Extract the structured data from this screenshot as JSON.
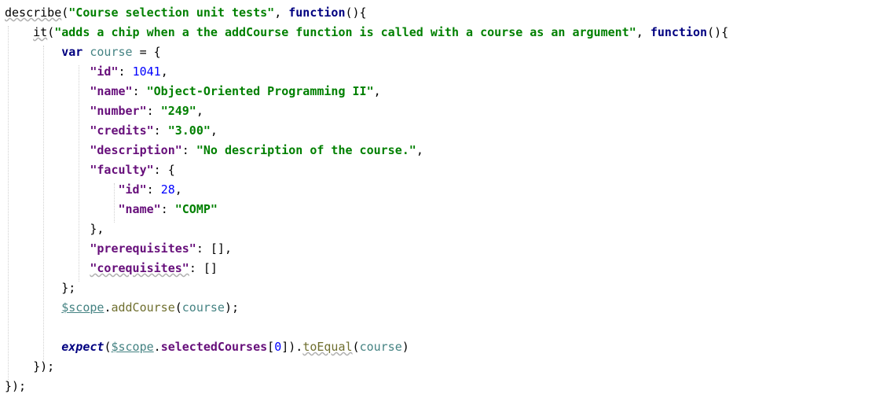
{
  "lines": [
    [
      {
        "t": "describe",
        "c": "plain",
        "w": 1
      },
      {
        "t": "(",
        "c": "plain"
      },
      {
        "t": "\"Course selection unit tests\"",
        "c": "str"
      },
      {
        "t": ", ",
        "c": "plain"
      },
      {
        "t": "function",
        "c": "kw"
      },
      {
        "t": "(){",
        "c": "plain"
      }
    ],
    [
      {
        "t": "    ",
        "c": "plain"
      },
      {
        "t": "it",
        "c": "plain",
        "w": 1
      },
      {
        "t": "(",
        "c": "plain"
      },
      {
        "t": "\"adds a chip when a the addCourse function is called with a course as an argument\"",
        "c": "str"
      },
      {
        "t": ", ",
        "c": "plain"
      },
      {
        "t": "function",
        "c": "kw"
      },
      {
        "t": "(){",
        "c": "plain"
      }
    ],
    [
      {
        "t": "        ",
        "c": "plain"
      },
      {
        "t": "var ",
        "c": "kw"
      },
      {
        "t": "course",
        "c": "var"
      },
      {
        "t": " = {",
        "c": "plain"
      }
    ],
    [
      {
        "t": "            ",
        "c": "plain"
      },
      {
        "t": "\"id\"",
        "c": "key"
      },
      {
        "t": ": ",
        "c": "plain"
      },
      {
        "t": "1041",
        "c": "num"
      },
      {
        "t": ",",
        "c": "plain"
      }
    ],
    [
      {
        "t": "            ",
        "c": "plain"
      },
      {
        "t": "\"name\"",
        "c": "key"
      },
      {
        "t": ": ",
        "c": "plain"
      },
      {
        "t": "\"Object-Oriented Programming II\"",
        "c": "str"
      },
      {
        "t": ",",
        "c": "plain"
      }
    ],
    [
      {
        "t": "            ",
        "c": "plain"
      },
      {
        "t": "\"number\"",
        "c": "key"
      },
      {
        "t": ": ",
        "c": "plain"
      },
      {
        "t": "\"249\"",
        "c": "str"
      },
      {
        "t": ",",
        "c": "plain"
      }
    ],
    [
      {
        "t": "            ",
        "c": "plain"
      },
      {
        "t": "\"credits\"",
        "c": "key"
      },
      {
        "t": ": ",
        "c": "plain"
      },
      {
        "t": "\"3.00\"",
        "c": "str"
      },
      {
        "t": ",",
        "c": "plain"
      }
    ],
    [
      {
        "t": "            ",
        "c": "plain"
      },
      {
        "t": "\"description\"",
        "c": "key"
      },
      {
        "t": ": ",
        "c": "plain"
      },
      {
        "t": "\"No description of the course.\"",
        "c": "str"
      },
      {
        "t": ",",
        "c": "plain"
      }
    ],
    [
      {
        "t": "            ",
        "c": "plain"
      },
      {
        "t": "\"faculty\"",
        "c": "key"
      },
      {
        "t": ": {",
        "c": "plain"
      }
    ],
    [
      {
        "t": "                ",
        "c": "plain"
      },
      {
        "t": "\"id\"",
        "c": "key"
      },
      {
        "t": ": ",
        "c": "plain"
      },
      {
        "t": "28",
        "c": "num"
      },
      {
        "t": ",",
        "c": "plain"
      }
    ],
    [
      {
        "t": "                ",
        "c": "plain"
      },
      {
        "t": "\"name\"",
        "c": "key"
      },
      {
        "t": ": ",
        "c": "plain"
      },
      {
        "t": "\"COMP\"",
        "c": "str"
      }
    ],
    [
      {
        "t": "            },",
        "c": "plain"
      }
    ],
    [
      {
        "t": "            ",
        "c": "plain"
      },
      {
        "t": "\"prerequisites\"",
        "c": "key"
      },
      {
        "t": ": [],",
        "c": "plain"
      }
    ],
    [
      {
        "t": "            ",
        "c": "plain"
      },
      {
        "t": "\"corequisites\"",
        "c": "key",
        "w": 1
      },
      {
        "t": ": []",
        "c": "plain"
      }
    ],
    [
      {
        "t": "        };",
        "c": "plain"
      }
    ],
    [
      {
        "t": "        ",
        "c": "plain"
      },
      {
        "t": "$scope",
        "c": "var",
        "u": 1
      },
      {
        "t": ".",
        "c": "plain"
      },
      {
        "t": "addCourse",
        "c": "fn"
      },
      {
        "t": "(",
        "c": "plain"
      },
      {
        "t": "course",
        "c": "var"
      },
      {
        "t": ");",
        "c": "plain"
      }
    ],
    [
      {
        "t": "",
        "c": "plain"
      }
    ],
    [
      {
        "t": "        ",
        "c": "plain"
      },
      {
        "t": "expect",
        "c": "kw",
        "i": 1
      },
      {
        "t": "(",
        "c": "plain"
      },
      {
        "t": "$scope",
        "c": "var",
        "u": 1
      },
      {
        "t": ".",
        "c": "plain"
      },
      {
        "t": "selectedCourses",
        "c": "prop"
      },
      {
        "t": "[",
        "c": "plain"
      },
      {
        "t": "0",
        "c": "num"
      },
      {
        "t": "]).",
        "c": "plain"
      },
      {
        "t": "toEqual",
        "c": "fn",
        "w": 1
      },
      {
        "t": "(",
        "c": "plain"
      },
      {
        "t": "course",
        "c": "var"
      },
      {
        "t": ")",
        "c": "plain"
      }
    ],
    [
      {
        "t": "    });",
        "c": "plain"
      }
    ],
    [
      {
        "t": "});",
        "c": "plain"
      }
    ]
  ]
}
